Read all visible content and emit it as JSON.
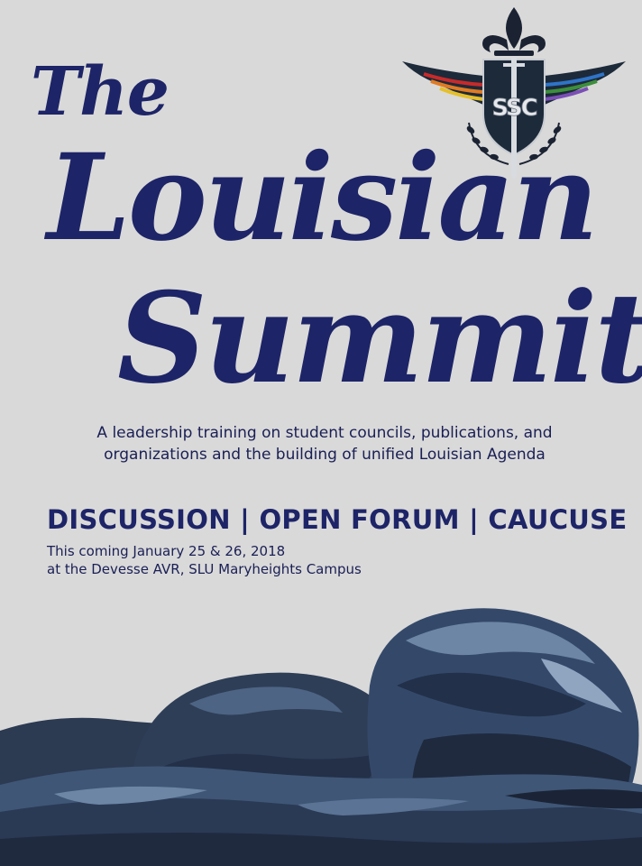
{
  "title": {
    "line1": "The",
    "line2": "Louisian",
    "line3": "Summit"
  },
  "tagline": {
    "line1": "A leadership training on student councils, publications, and",
    "line2": "organizations and the building of unified Louisian Agenda"
  },
  "activities": "DISCUSSION | OPEN FORUM | CAUCUSE",
  "schedule": {
    "date": "This coming January 25 & 26, 2018",
    "venue": "at the Devesse AVR, SLU Maryheights Campus"
  },
  "logo": {
    "letters": "SSC",
    "icon": "fleur-de-lis-icon"
  },
  "colors": {
    "background": "#d9d9d9",
    "navy": "#1d2467",
    "rock_dark": "#1f2a3e",
    "rock_mid": "#3f5676",
    "rock_light": "#6d86a6"
  }
}
